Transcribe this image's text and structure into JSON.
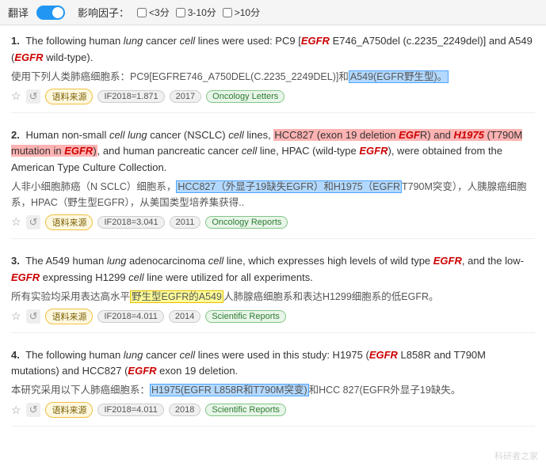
{
  "topbar": {
    "translate_label": "翻译",
    "toggle_state": true,
    "filter_label": "影响因子：",
    "filters": [
      {
        "label": "<3分",
        "checked": false
      },
      {
        "label": "3-10分",
        "checked": false
      },
      {
        "label": ">10分",
        "checked": false
      }
    ]
  },
  "results": [
    {
      "number": "1.",
      "text_segments": [
        {
          "type": "normal",
          "text": "The following human "
        },
        {
          "type": "italic",
          "text": "lung"
        },
        {
          "type": "normal",
          "text": " cancer "
        },
        {
          "type": "italic",
          "text": "cell"
        },
        {
          "type": "normal",
          "text": " lines were used: PC9 ["
        },
        {
          "type": "bold-italic-red",
          "text": "EGFR"
        },
        {
          "type": "normal",
          "text": " E746_A750del (c.2235_2249del)] and A549 ("
        },
        {
          "type": "bold-italic-red",
          "text": "EGFR"
        },
        {
          "type": "normal",
          "text": " wild-type)."
        }
      ],
      "chinese_segments": [
        {
          "type": "normal",
          "text": "使用下列人类肺癌细胞系：PC9[EGFRE746_A750DEL(C.2235_2249DEL)]和"
        },
        {
          "type": "highlight-blue",
          "text": "A549(EGFR野生型)。"
        }
      ],
      "meta": {
        "source_label": "语料来源",
        "if_label": "IF2018=1.871",
        "year_label": "2017",
        "journal_label": "Oncology Letters"
      }
    },
    {
      "number": "2.",
      "text_segments": [
        {
          "type": "normal",
          "text": "Human non-small "
        },
        {
          "type": "italic",
          "text": "cell lung"
        },
        {
          "type": "normal",
          "text": " cancer (NSCLC) "
        },
        {
          "type": "italic",
          "text": "cell"
        },
        {
          "type": "normal",
          "text": " lines, "
        },
        {
          "type": "highlight-red",
          "text": "HCC827 (exon 19 deletion "
        },
        {
          "type": "highlight-red-italic",
          "text": "EGF"
        },
        {
          "type": "normal",
          "text": "\nR) and "
        },
        {
          "type": "highlight-red",
          "text": "H1975 (T790M mutation in "
        },
        {
          "type": "highlight-red-italic",
          "text": "EGFR"
        },
        {
          "type": "highlight-red",
          "text": ")"
        },
        {
          "type": "normal",
          "text": ", and human pancreatic cancer "
        },
        {
          "type": "italic",
          "text": "cell"
        },
        {
          "type": "normal",
          "text": " line, HPAC (wild-type "
        },
        {
          "type": "bold-italic-red",
          "text": "EGFR"
        },
        {
          "type": "normal",
          "text": "), were obtained from the American Type Culture Collection."
        }
      ],
      "chinese_segments": [
        {
          "type": "normal",
          "text": "人非小细胞肺癌（N SCLC）细胞系，"
        },
        {
          "type": "highlight-blue",
          "text": "HCC827（外显子19缺失EGFR）和H1975（EGFR"
        },
        {
          "type": "normal",
          "text": "T790M突变），人胰腺癌细胞系，HPAC（野生型EGFR），从美国类型培养集获得.."
        }
      ],
      "meta": {
        "source_label": "语料来源",
        "if_label": "IF2018=3.041",
        "year_label": "2011",
        "journal_label": "Oncology Reports"
      }
    },
    {
      "number": "3.",
      "text_segments": [
        {
          "type": "normal",
          "text": "The A549 human "
        },
        {
          "type": "italic",
          "text": "lung"
        },
        {
          "type": "normal",
          "text": " adenocarcinoma "
        },
        {
          "type": "italic",
          "text": "cell"
        },
        {
          "type": "normal",
          "text": " line, which expresses high levels of wild type "
        },
        {
          "type": "bold-italic-red",
          "text": "EGFR"
        },
        {
          "type": "normal",
          "text": ", and the low-"
        },
        {
          "type": "bold-italic-red",
          "text": "EGFR"
        },
        {
          "type": "normal",
          "text": " expressing H1299 "
        },
        {
          "type": "italic",
          "text": "cell"
        },
        {
          "type": "normal",
          "text": " line were utilized for all experiments."
        }
      ],
      "chinese_segments": [
        {
          "type": "normal",
          "text": "所有实验均采用表达高水平"
        },
        {
          "type": "highlight-yellow",
          "text": "野生型EGFR的A549"
        },
        {
          "type": "normal",
          "text": "人肺腺癌细胞系和表达H1299细胞系的低EGFR。"
        }
      ],
      "meta": {
        "source_label": "语料来源",
        "if_label": "IF2018=4.011",
        "year_label": "2014",
        "journal_label": "Scientific Reports"
      }
    },
    {
      "number": "4.",
      "text_segments": [
        {
          "type": "normal",
          "text": "The following human "
        },
        {
          "type": "italic",
          "text": "lung"
        },
        {
          "type": "normal",
          "text": " cancer "
        },
        {
          "type": "italic",
          "text": "cell"
        },
        {
          "type": "normal",
          "text": " lines were used in this study: H1975 ("
        },
        {
          "type": "bold-italic-red",
          "text": "EGFR"
        },
        {
          "type": "normal",
          "text": " L858R and T790M mutations) and HCC827 ("
        },
        {
          "type": "bold-italic-red",
          "text": "EGFR"
        },
        {
          "type": "normal",
          "text": " exon 19 deletion."
        }
      ],
      "chinese_segments": [
        {
          "type": "normal",
          "text": "本研究采用以下人肺癌细胞系："
        },
        {
          "type": "highlight-blue",
          "text": "H1975(EGFR L858R和T790M突变)"
        },
        {
          "type": "normal",
          "text": "和HCC 827(EGFR外显子19缺失。"
        }
      ],
      "meta": {
        "source_label": "语料来源",
        "if_label": "IF2018=4.011",
        "year_label": "2018",
        "journal_label": "Scientific Reports"
      }
    }
  ],
  "watermark": "科研者之家"
}
